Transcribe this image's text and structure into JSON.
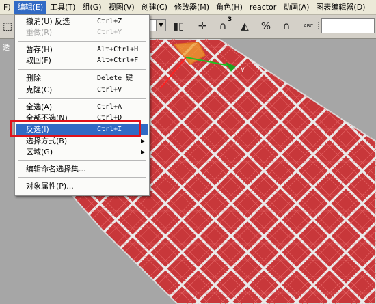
{
  "menubar": {
    "items": [
      "F)",
      "编辑(E)",
      "工具(T)",
      "组(G)",
      "视图(V)",
      "创建(C)",
      "修改器(M)",
      "角色(H)",
      "reactor",
      "动画(A)",
      "图表编辑器(D)"
    ],
    "active": "编辑(E)"
  },
  "toolbar": {
    "ref_coord_value": "",
    "snap_angle_label": "3",
    "percent_label": "%",
    "abc_label": "ABC",
    "named_selection_value": ""
  },
  "viewport": {
    "label": "透",
    "axis_y_label": "y"
  },
  "edit_menu": {
    "undo": {
      "label": "撤消(U) 反选",
      "shortcut": "Ctrl+Z"
    },
    "redo": {
      "label": "重做(R)",
      "shortcut": "Ctrl+Y",
      "disabled": true
    },
    "hold": {
      "label": "暂存(H)",
      "shortcut": "Alt+Ctrl+H"
    },
    "fetch": {
      "label": "取回(F)",
      "shortcut": "Alt+Ctrl+F"
    },
    "delete": {
      "label": "删除",
      "shortcut": "Delete 键"
    },
    "clone": {
      "label": "克隆(C)",
      "shortcut": "Ctrl+V"
    },
    "select_all": {
      "label": "全选(A)",
      "shortcut": "Ctrl+A"
    },
    "select_none": {
      "label": "全部不选(N)",
      "shortcut": "Ctrl+D"
    },
    "select_invert": {
      "label": "反选(I)",
      "shortcut": "Ctrl+I"
    },
    "select_by": {
      "label": "选择方式(B)"
    },
    "region": {
      "label": "区域(G)"
    },
    "edit_named_sel": {
      "label": "编辑命名选择集..."
    },
    "object_props": {
      "label": "对象属性(P)..."
    }
  },
  "colors": {
    "menu_highlight": "#316ac5",
    "callout_red": "#e0111b",
    "mesh_red": "#c8373a"
  }
}
